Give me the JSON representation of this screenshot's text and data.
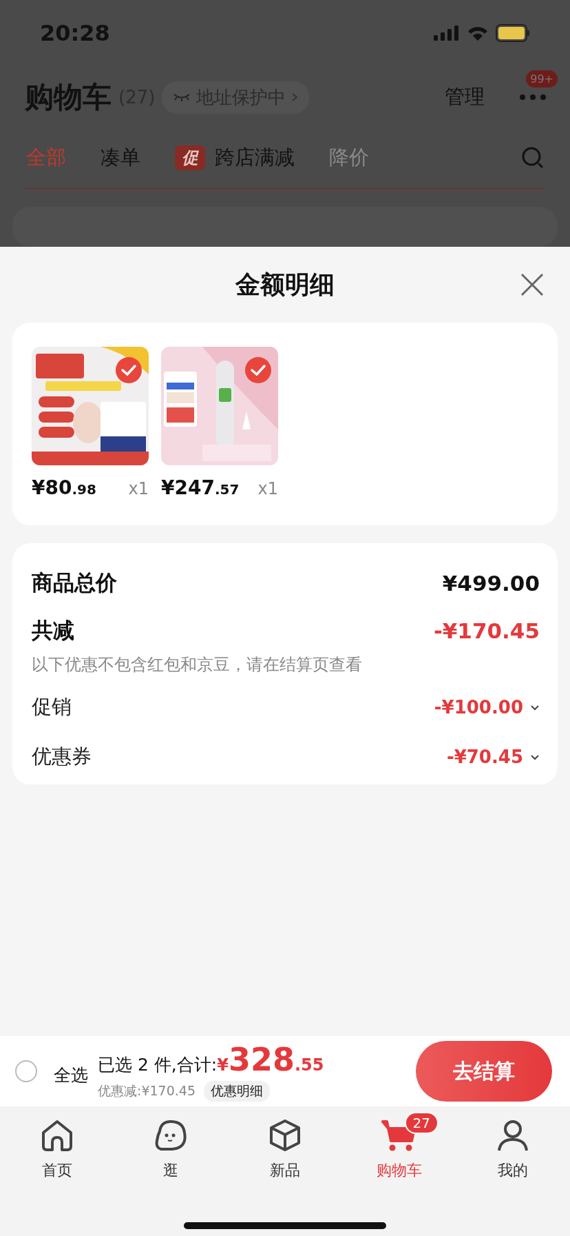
{
  "status_bar": {
    "time": "20:28"
  },
  "header": {
    "title": "购物车",
    "count": "(27)",
    "address_chip": "地址保护中",
    "manage": "管理",
    "more_badge": "99+"
  },
  "tabs": [
    {
      "label": "全部",
      "selected": true,
      "kind": "plain"
    },
    {
      "label": "凑单",
      "selected": false,
      "kind": "plain"
    },
    {
      "label": "跨店满减",
      "tag": "促",
      "selected": false,
      "kind": "promo"
    },
    {
      "label": "降价",
      "selected": false,
      "kind": "faded"
    }
  ],
  "sheet": {
    "title": "金额明细",
    "items": [
      {
        "price_main": "¥80",
        "price_decimal": ".98",
        "quantity": "x1",
        "checked": true
      },
      {
        "price_main": "¥247",
        "price_decimal": ".57",
        "quantity": "x1",
        "checked": true
      }
    ],
    "rows": [
      {
        "kind": "total",
        "label": "商品总价",
        "value": "¥499.00"
      },
      {
        "kind": "reduction",
        "label": "共减",
        "value": "-¥170.45",
        "note": "以下优惠不包含红包和京豆，请在结算页查看"
      },
      {
        "kind": "detail",
        "label": "促销",
        "value": "-¥100.00"
      },
      {
        "kind": "detail",
        "label": "优惠券",
        "value": "-¥70.45"
      }
    ]
  },
  "checkout_bar": {
    "select_all": {
      "label": "全选",
      "checked": false
    },
    "summary": "已选 2 件,合计:",
    "total_currency": "¥",
    "total_main": "328",
    "total_decimal": ".55",
    "discount": "优惠减:¥170.45",
    "detail_button": "优惠明细",
    "checkout_button": "去结算"
  },
  "bottom_nav": [
    {
      "label": "首页",
      "selected": false
    },
    {
      "label": "逛",
      "selected": false
    },
    {
      "label": "新品",
      "selected": false
    },
    {
      "label": "购物车",
      "selected": true,
      "badge": "27"
    },
    {
      "label": "我的",
      "selected": false
    }
  ]
}
